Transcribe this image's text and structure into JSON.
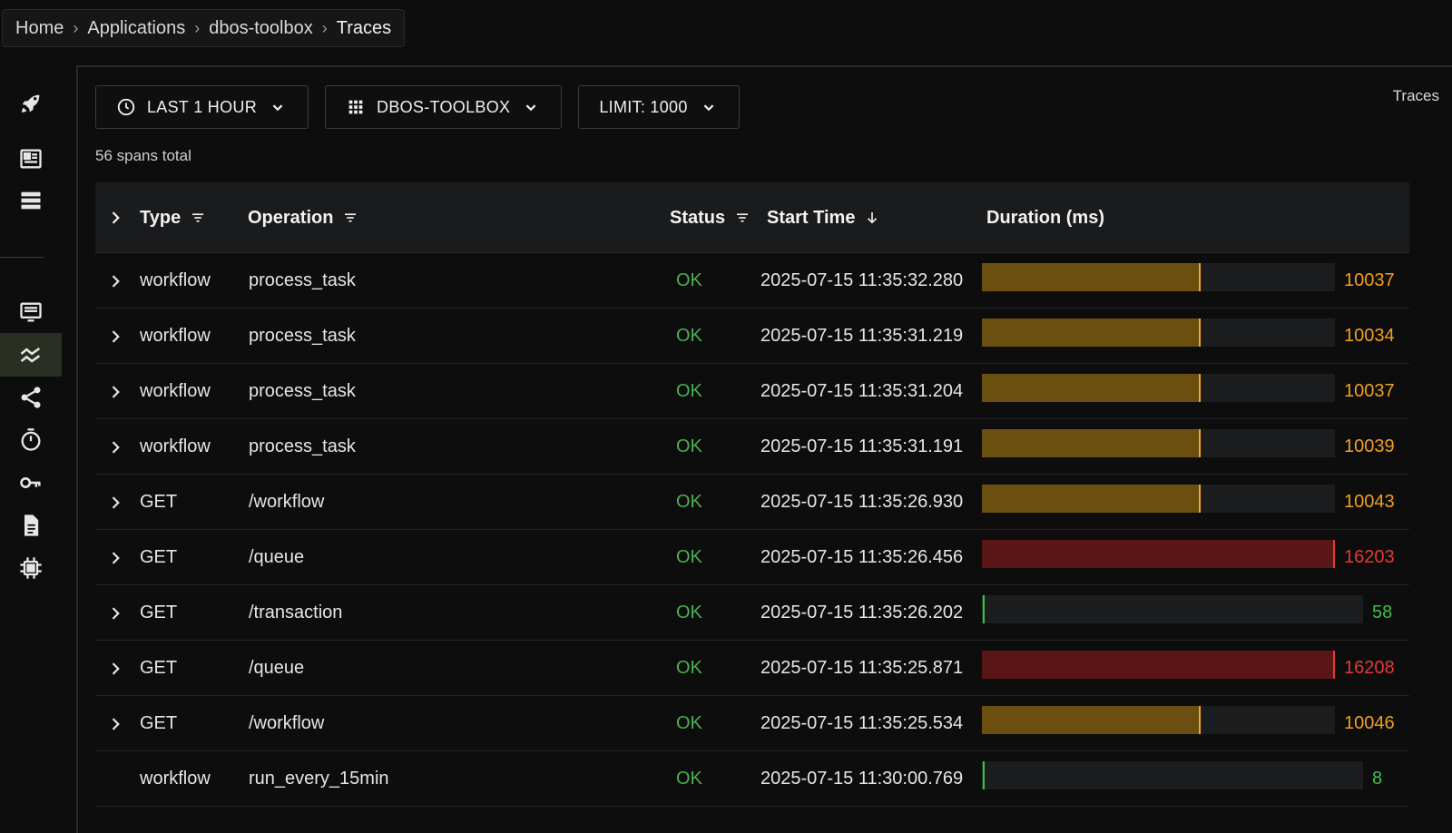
{
  "breadcrumb": [
    "Home",
    "Applications",
    "dbos-toolbox",
    "Traces"
  ],
  "breadcrumb_sep": "›",
  "page_label": "Traces",
  "filters": {
    "time": "LAST 1 HOUR",
    "app": "DBOS-TOOLBOX",
    "limit": "LIMIT: 1000"
  },
  "spans_total": "56 spans total",
  "table": {
    "headers": {
      "type": "Type",
      "operation": "Operation",
      "status": "Status",
      "start_time": "Start Time",
      "duration": "Duration (ms)"
    },
    "rows": [
      {
        "type": "workflow",
        "operation": "process_task",
        "status": "OK",
        "start": "2025-07-15 11:35:32.280",
        "duration": "10037",
        "fraction": 0.62,
        "color": "#6b4f10",
        "edge": "#f5a623",
        "textColor": "#f0a020",
        "expandable": true
      },
      {
        "type": "workflow",
        "operation": "process_task",
        "status": "OK",
        "start": "2025-07-15 11:35:31.219",
        "duration": "10034",
        "fraction": 0.62,
        "color": "#6b4f10",
        "edge": "#f5a623",
        "textColor": "#f0a020",
        "expandable": true
      },
      {
        "type": "workflow",
        "operation": "process_task",
        "status": "OK",
        "start": "2025-07-15 11:35:31.204",
        "duration": "10037",
        "fraction": 0.62,
        "color": "#6b4f10",
        "edge": "#f5a623",
        "textColor": "#f0a020",
        "expandable": true
      },
      {
        "type": "workflow",
        "operation": "process_task",
        "status": "OK",
        "start": "2025-07-15 11:35:31.191",
        "duration": "10039",
        "fraction": 0.62,
        "color": "#6b4f10",
        "edge": "#f5a623",
        "textColor": "#f0a020",
        "expandable": true
      },
      {
        "type": "GET",
        "operation": "/workflow",
        "status": "OK",
        "start": "2025-07-15 11:35:26.930",
        "duration": "10043",
        "fraction": 0.62,
        "color": "#6b4f10",
        "edge": "#f5a623",
        "textColor": "#f0a020",
        "expandable": true
      },
      {
        "type": "GET",
        "operation": "/queue",
        "status": "OK",
        "start": "2025-07-15 11:35:26.456",
        "duration": "16203",
        "fraction": 1.0,
        "color": "#5a1517",
        "edge": "#e53935",
        "textColor": "#e53935",
        "expandable": true
      },
      {
        "type": "GET",
        "operation": "/transaction",
        "status": "OK",
        "start": "2025-07-15 11:35:26.202",
        "duration": "58",
        "fraction": 0.004,
        "color": "#1a3d1c",
        "edge": "#3fbf4a",
        "textColor": "#3fbf4a",
        "expandable": true
      },
      {
        "type": "GET",
        "operation": "/queue",
        "status": "OK",
        "start": "2025-07-15 11:35:25.871",
        "duration": "16208",
        "fraction": 1.0,
        "color": "#5a1517",
        "edge": "#e53935",
        "textColor": "#e53935",
        "expandable": true
      },
      {
        "type": "GET",
        "operation": "/workflow",
        "status": "OK",
        "start": "2025-07-15 11:35:25.534",
        "duration": "10046",
        "fraction": 0.62,
        "color": "#6b4f10",
        "edge": "#f5a623",
        "textColor": "#f0a020",
        "expandable": true
      },
      {
        "type": "workflow",
        "operation": "run_every_15min",
        "status": "OK",
        "start": "2025-07-15 11:30:00.769",
        "duration": "8",
        "fraction": 0.001,
        "color": "#1a3d1c",
        "edge": "#3fbf4a",
        "textColor": "#3fbf4a",
        "expandable": false
      }
    ]
  },
  "sidebar": {
    "icons": [
      "rocket-icon",
      "dashboard-icon",
      "list-icon",
      "monitor-icon",
      "traces-icon",
      "share-icon",
      "timer-icon",
      "key-icon",
      "document-icon",
      "chip-icon"
    ],
    "active": "traces-icon"
  },
  "colors": {
    "accent_active_bg": "#2a2f23",
    "status_ok": "#4caf50"
  }
}
